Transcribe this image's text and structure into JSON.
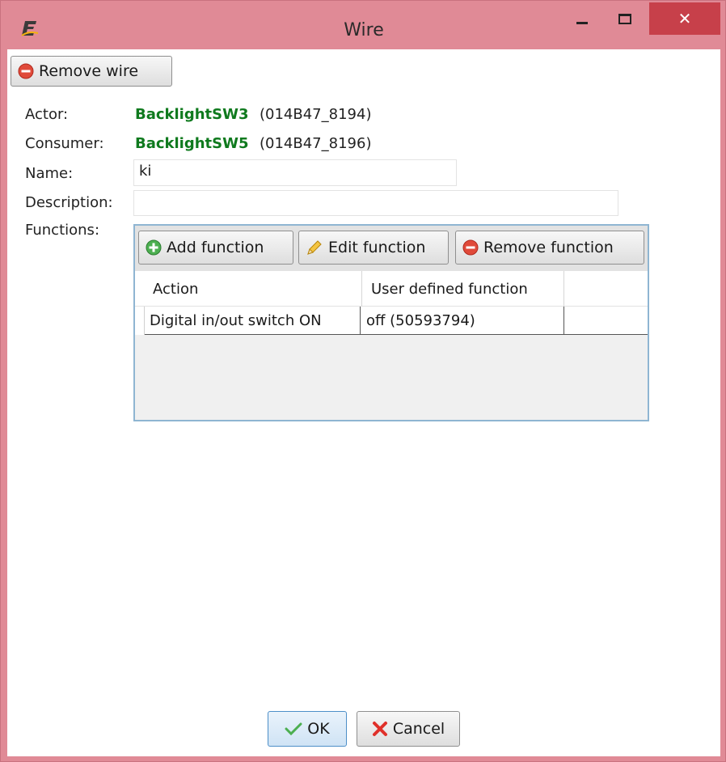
{
  "window": {
    "title": "Wire",
    "app_icon": "e-logo-icon",
    "close_glyph": "✕",
    "colors": {
      "frame": "#e08a96",
      "close": "#c7404a"
    }
  },
  "toolbar": {
    "remove_wire_label": "Remove wire"
  },
  "fields": {
    "actor_label": "Actor:",
    "actor_name": "BacklightSW3",
    "actor_id": "(014B47_8194)",
    "consumer_label": "Consumer:",
    "consumer_name": "BacklightSW5",
    "consumer_id": "(014B47_8196)",
    "name_label": "Name:",
    "name_value": "ki",
    "description_label": "Description:",
    "description_value": "",
    "functions_label": "Functions:"
  },
  "functions": {
    "add_label": "Add function",
    "edit_label": "Edit function",
    "remove_label": "Remove function",
    "columns": [
      "Action",
      "User defined function"
    ],
    "rows": [
      {
        "action": "Digital in/out switch ON",
        "user_function": "off (50593794)"
      }
    ]
  },
  "footer": {
    "ok_label": "OK",
    "cancel_label": "Cancel"
  },
  "colors": {
    "actor_name": "#0f7a1e",
    "grid_border": "#8fb5d2"
  }
}
